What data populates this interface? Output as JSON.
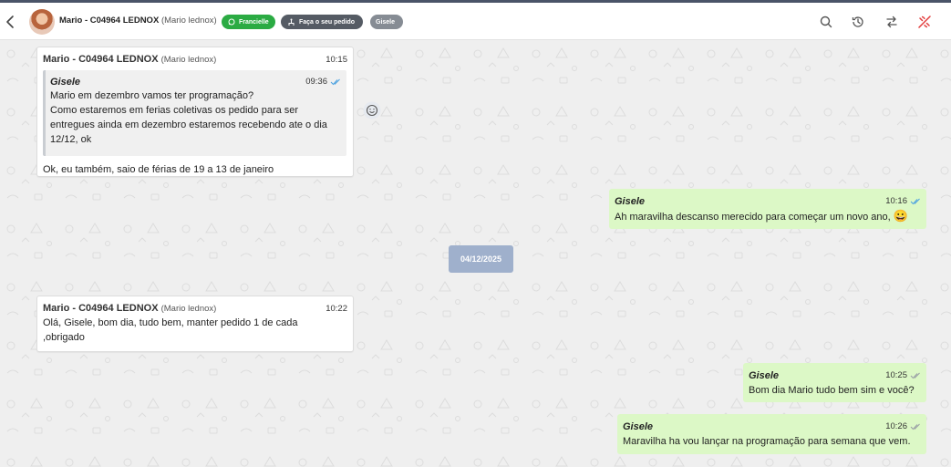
{
  "header": {
    "contact_name": "Mario - C04964 LEDNOX",
    "contact_sub": "(Mario lednox)",
    "tags": [
      "Francielle",
      "Faça o seu pedido",
      "Gisele"
    ],
    "colors": {
      "tag_green": "#2bab43",
      "tag_dark": "#555b64",
      "tag_grey": "#868c94",
      "accent_red": "#e23b3b"
    },
    "icons": [
      "back-icon",
      "avatar",
      "whatsapp-icon",
      "flow-icon",
      "search-icon",
      "history-icon",
      "transfer-icon",
      "close-ticket-icon"
    ]
  },
  "messages": {
    "m1": {
      "name": "Mario - C04964 LEDNOX",
      "sub": "(Mario lednox)",
      "time": "10:15",
      "quote": {
        "sender": "Gisele",
        "time": "09:36",
        "lines": [
          "Mario em dezembro vamos ter programação?",
          "Como estaremos em ferias coletivas os pedido para ser",
          "entregues ainda em dezembro estaremos recebendo ate o dia",
          "12/12, ok"
        ]
      },
      "text": "Ok, eu também, saio de férias de 19 a 13 de janeiro"
    },
    "m2": {
      "sender": "Gisele",
      "time": "10:16",
      "text": "Ah maravilha descanso merecido para começar um novo ano,",
      "emoji": "😀"
    },
    "date_separator": "04/12/2025",
    "m3": {
      "name": "Mario - C04964 LEDNOX",
      "sub": "(Mario lednox)",
      "time": "10:22",
      "lines": [
        "Olá, Gisele, bom dia, tudo bem, manter pedido 1 de cada",
        ",obrigado"
      ]
    },
    "m4": {
      "sender": "Gisele",
      "time": "10:25",
      "text": "Bom dia Mario tudo bem sim e você?"
    },
    "m5": {
      "sender": "Gisele",
      "time": "10:26",
      "text": "Maravilha ha vou lançar na programação para semana que vem."
    }
  }
}
